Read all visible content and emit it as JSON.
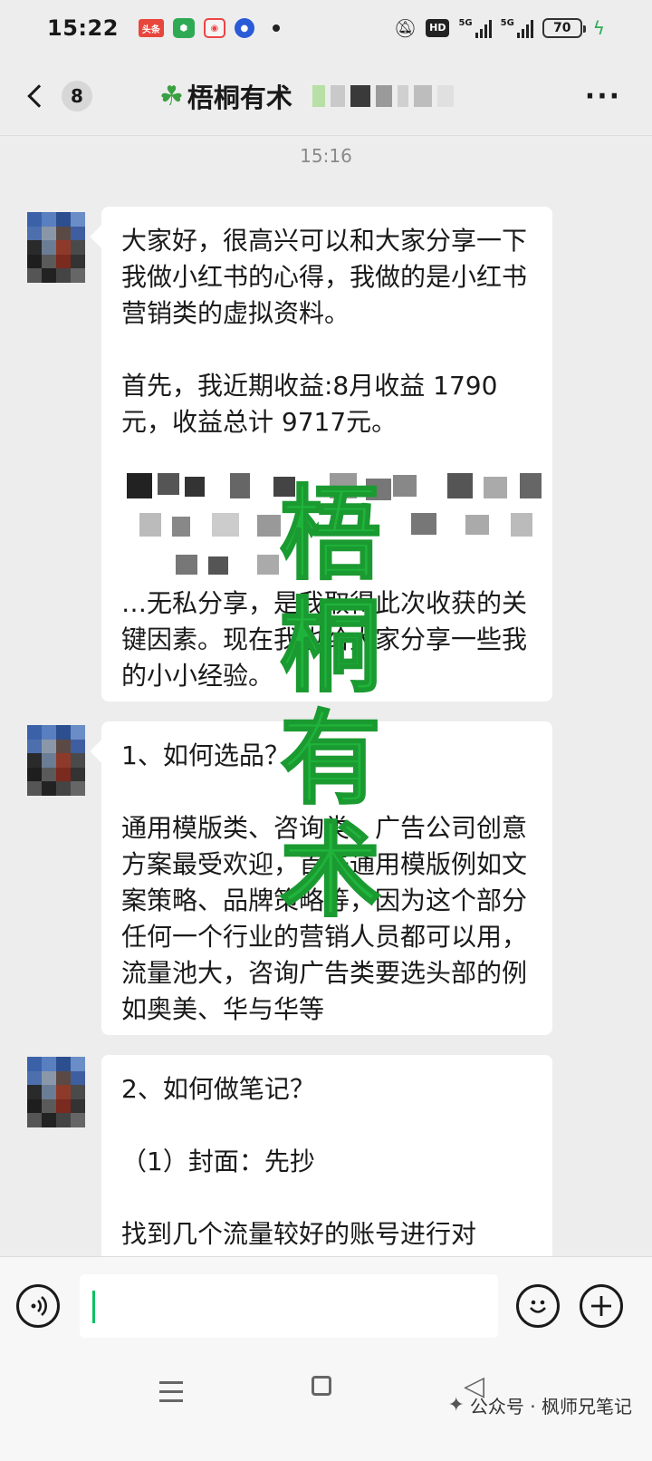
{
  "status_bar": {
    "time": "15:22",
    "notif_label": "头条",
    "hd": "HD",
    "signal1": "5G",
    "signal2": "5G",
    "battery": "70"
  },
  "header": {
    "back_count": "8",
    "title": "梧桐有术",
    "more": "···"
  },
  "chat": {
    "timestamp": "15:16",
    "messages": [
      {
        "paragraphs": [
          "大家好，很高兴可以和大家分享一下我做小红书的心得，我做的是小红书营销类的虚拟资料。",
          "首先，我近期收益:8月收益 1790元，收益总计 9717元。"
        ],
        "tail": "…无私分享，是我取得此次收获的关键因素。现在我也给大家分享一些我的小小经验。"
      },
      {
        "paragraphs": [
          "1、如何选品？",
          "通用模版类、咨询类、广告公司创意方案最受欢迎，首先通用模版例如文案策略、品牌策略等，因为这个部分任何一个行业的营销人员都可以用，流量池大，咨询广告类要选头部的例如奥美、华与华等"
        ]
      },
      {
        "paragraphs": [
          "2、如何做笔记？",
          "（1）封面：先抄",
          "找到几个流量较好的账号进行对"
        ]
      }
    ]
  },
  "watermark": [
    "梧",
    "桐",
    "有",
    "术"
  ],
  "input_bar": {
    "voice_icon": "voice-icon",
    "emoji_icon": "emoji-icon",
    "plus_icon": "plus-icon"
  },
  "footer": {
    "credit": "公众号 · 枫师兄笔记"
  },
  "colors": {
    "background": "#ededed",
    "bubble": "#ffffff",
    "watermark_green": "#1fb33b",
    "caret_green": "#07c160"
  }
}
